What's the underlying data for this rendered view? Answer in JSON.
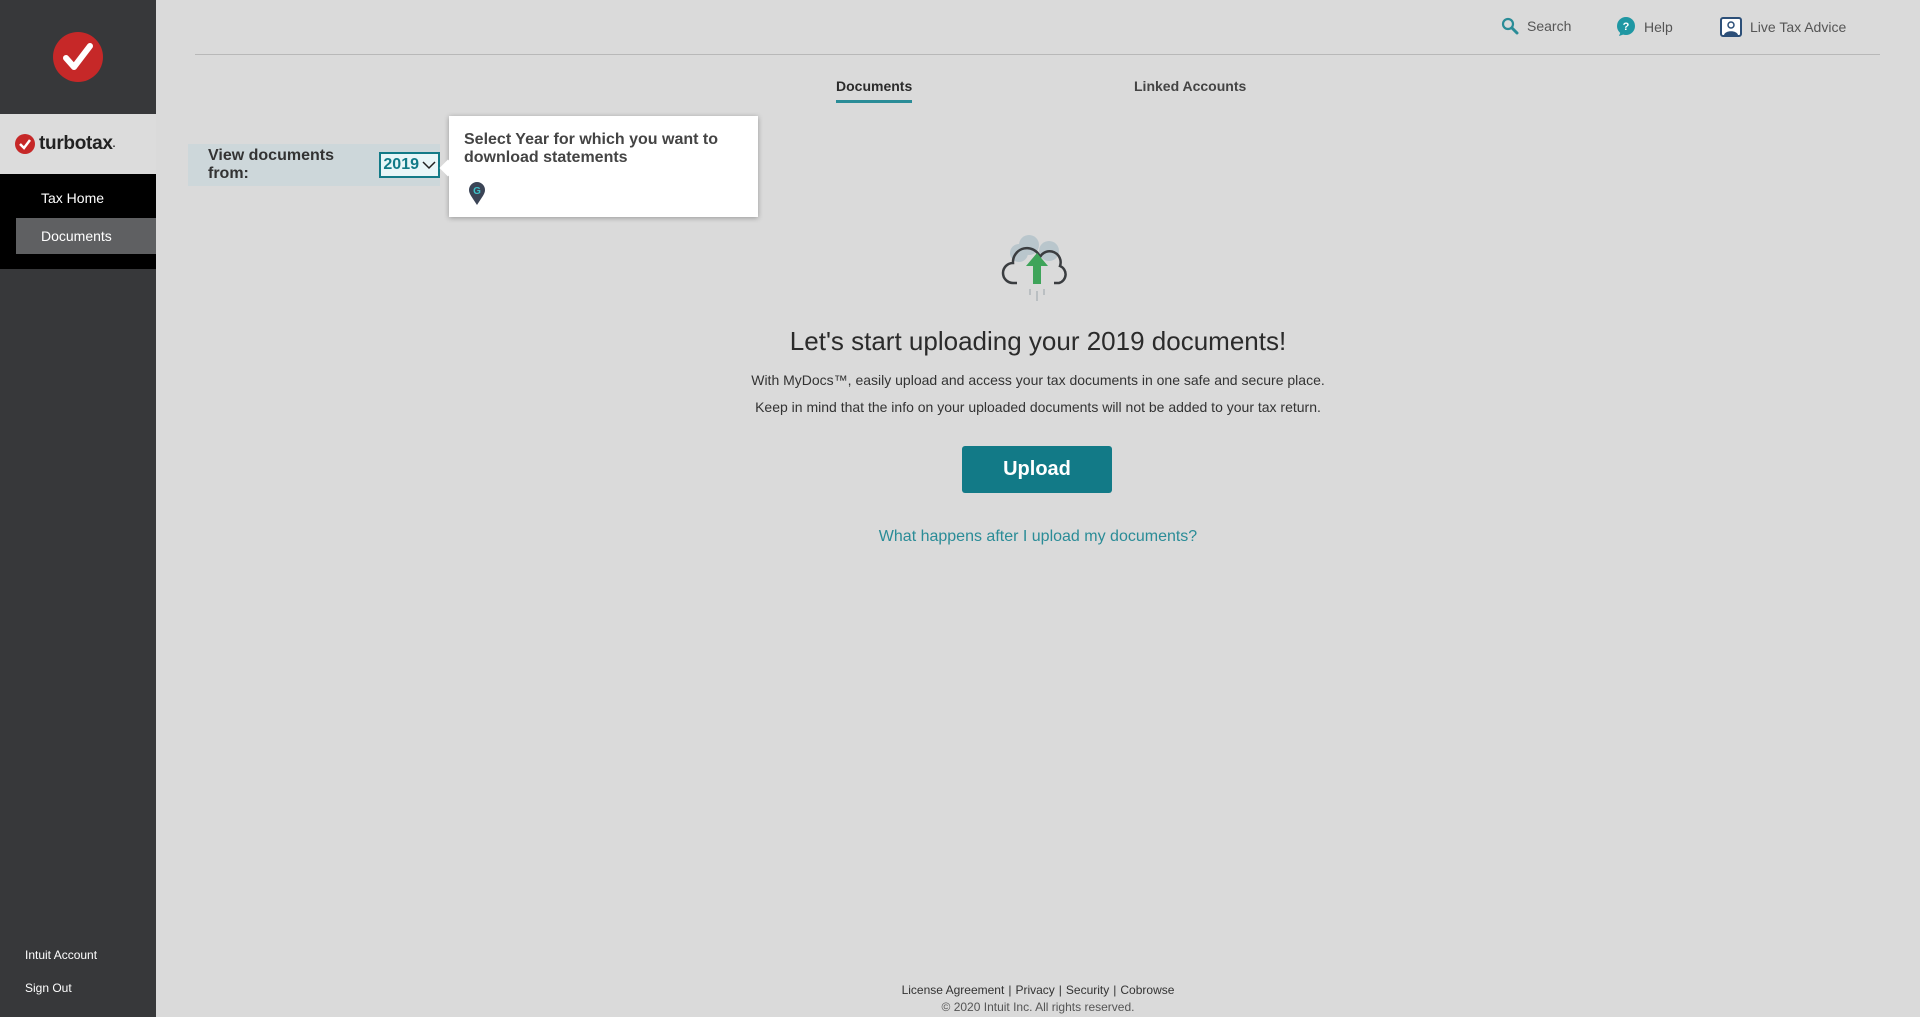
{
  "brand": {
    "name": "turbotax",
    "accent": "#c62828"
  },
  "sidebar": {
    "items": [
      {
        "label": "Tax Home"
      },
      {
        "label": "Documents",
        "active": true
      }
    ],
    "bottom": [
      {
        "label": "Intuit Account"
      },
      {
        "label": "Sign Out"
      }
    ]
  },
  "header": {
    "search": "Search",
    "help": "Help",
    "live": "Live Tax Advice"
  },
  "tabs": [
    {
      "label": "Documents",
      "active": true
    },
    {
      "label": "Linked Accounts"
    }
  ],
  "view": {
    "label": "View documents from:",
    "year": "2019"
  },
  "tooltip": {
    "text": "Select Year for which you want to download statements"
  },
  "main": {
    "heading": "Let's start uploading your 2019 documents!",
    "line1": "With MyDocs™, easily upload and access your tax documents in one safe and secure place.",
    "line2": "Keep in mind that the info on your uploaded documents will not be added to your tax return.",
    "upload": "Upload",
    "link": "What happens after I upload my documents?"
  },
  "footer": {
    "links": [
      "License Agreement",
      "Privacy",
      "Security",
      "Cobrowse"
    ],
    "copyright": "© 2020 Intuit Inc. All rights reserved."
  },
  "colors": {
    "primary": "#127a87",
    "link": "#2a8c97",
    "sidebar": "#37383a"
  }
}
